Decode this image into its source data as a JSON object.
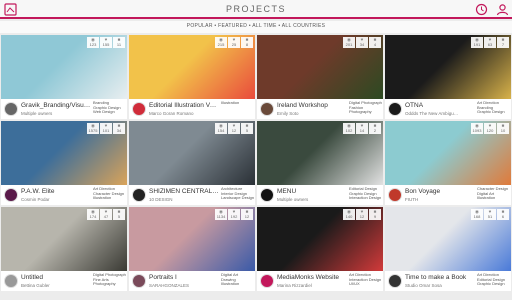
{
  "header": {
    "title": "PROJECTS"
  },
  "filters": "POPULAR • FEATURED • ALL TIME • ALL COUNTRIES",
  "projects": [
    {
      "title": "Gravik_Branding/Visu…",
      "owner": "Multiple owners",
      "fields": [
        "Branding",
        "Graphic Design",
        "Web Design"
      ],
      "views": "123",
      "likes": "155",
      "comments": "11",
      "thumb": "#8fc8d6",
      "thumb2": "#e8eef0",
      "avatar": "#666666"
    },
    {
      "title": "Editorial Illustration Vo…",
      "owner": "Marco Goran Romano",
      "fields": [
        "Illustration"
      ],
      "views": "215",
      "likes": "25",
      "comments": "8",
      "thumb": "#f2c24a",
      "thumb2": "#e94b3c",
      "avatar": "#d02c3a"
    },
    {
      "title": "Ireland Workshop",
      "owner": "Emily Soto",
      "fields": [
        "Digital Photography",
        "Fashion",
        "Photography"
      ],
      "views": "201",
      "likes": "34",
      "comments": "4",
      "thumb": "#6e3a2a",
      "thumb2": "#2c4a22",
      "avatar": "#6a4a3a"
    },
    {
      "title": "OTNA",
      "owner": "Oddds The New Ambigu…",
      "fields": [
        "Art Direction",
        "Branding",
        "Graphic Design"
      ],
      "views": "191",
      "likes": "63",
      "comments": "7",
      "thumb": "#1b1b1b",
      "thumb2": "#d8b24a",
      "avatar": "#1a1a1a"
    },
    {
      "title": "P.A.W. Elite",
      "owner": "Cosmin Podar",
      "fields": [
        "Art Direction",
        "Character Design",
        "Illustration"
      ],
      "views": "1575",
      "likes": "101",
      "comments": "34",
      "thumb": "#3d6e9a",
      "thumb2": "#d9a35a",
      "avatar": "#5a1a4a"
    },
    {
      "title": "SHIZIMEN CENTRAL…",
      "owner": "10 DESIGN",
      "fields": [
        "Architecture",
        "Interior Design",
        "Landscape Design"
      ],
      "views": "154",
      "likes": "12",
      "comments": "5",
      "thumb": "#7f8a92",
      "thumb2": "#2a3036",
      "avatar": "#222222"
    },
    {
      "title": "MENU",
      "owner": "Multiple owners",
      "fields": [
        "Editorial Design",
        "Graphic Design",
        "Interaction Design"
      ],
      "views": "102",
      "likes": "14",
      "comments": "2",
      "thumb": "#3a4a3e",
      "thumb2": "#e2e2e2",
      "avatar": "#111111"
    },
    {
      "title": "Bon Voyage",
      "owner": "FIUTH",
      "fields": [
        "Character Design",
        "Digital Art",
        "Illustration"
      ],
      "views": "1093",
      "likes": "120",
      "comments": "10",
      "thumb": "#8ccbd0",
      "thumb2": "#e07a3a",
      "avatar": "#c0392b"
    },
    {
      "title": "Untitled",
      "owner": "Bettina Gubler",
      "fields": [
        "Digital Photography",
        "Fine Arts",
        "Photography"
      ],
      "views": "174",
      "likes": "47",
      "comments": "5",
      "thumb": "#b7b5ac",
      "thumb2": "#3a3a34",
      "avatar": "#999999"
    },
    {
      "title": "Portraits I",
      "owner": "SARAHGONZALES",
      "fields": [
        "Digital Art",
        "Drawing",
        "Illustration"
      ],
      "views": "1134",
      "likes": "192",
      "comments": "12",
      "thumb": "#c89aa0",
      "thumb2": "#3a5aa8",
      "avatar": "#7a4a5a"
    },
    {
      "title": "MediaMonks Website",
      "owner": "Marina Rizzardiel",
      "fields": [
        "Art Direction",
        "Interaction Design",
        "UI/UX"
      ],
      "views": "140",
      "likes": "12",
      "comments": "9",
      "thumb": "#1a1a1a",
      "thumb2": "#d23a3a",
      "avatar": "#c2185b"
    },
    {
      "title": "Time to make a Book",
      "owner": "Studio Omar Sosa",
      "fields": [
        "Art Direction",
        "Editorial Design",
        "Graphic Design"
      ],
      "views": "168",
      "likes": "51",
      "comments": "6",
      "thumb": "#e4e6ea",
      "thumb2": "#4a7ad8",
      "avatar": "#333333"
    }
  ],
  "colors": {
    "accent": "#c2185b",
    "background": "#ececec"
  },
  "icons": {
    "left": "menu-grid-icon",
    "right1": "refresh-icon",
    "right2": "user-icon"
  }
}
